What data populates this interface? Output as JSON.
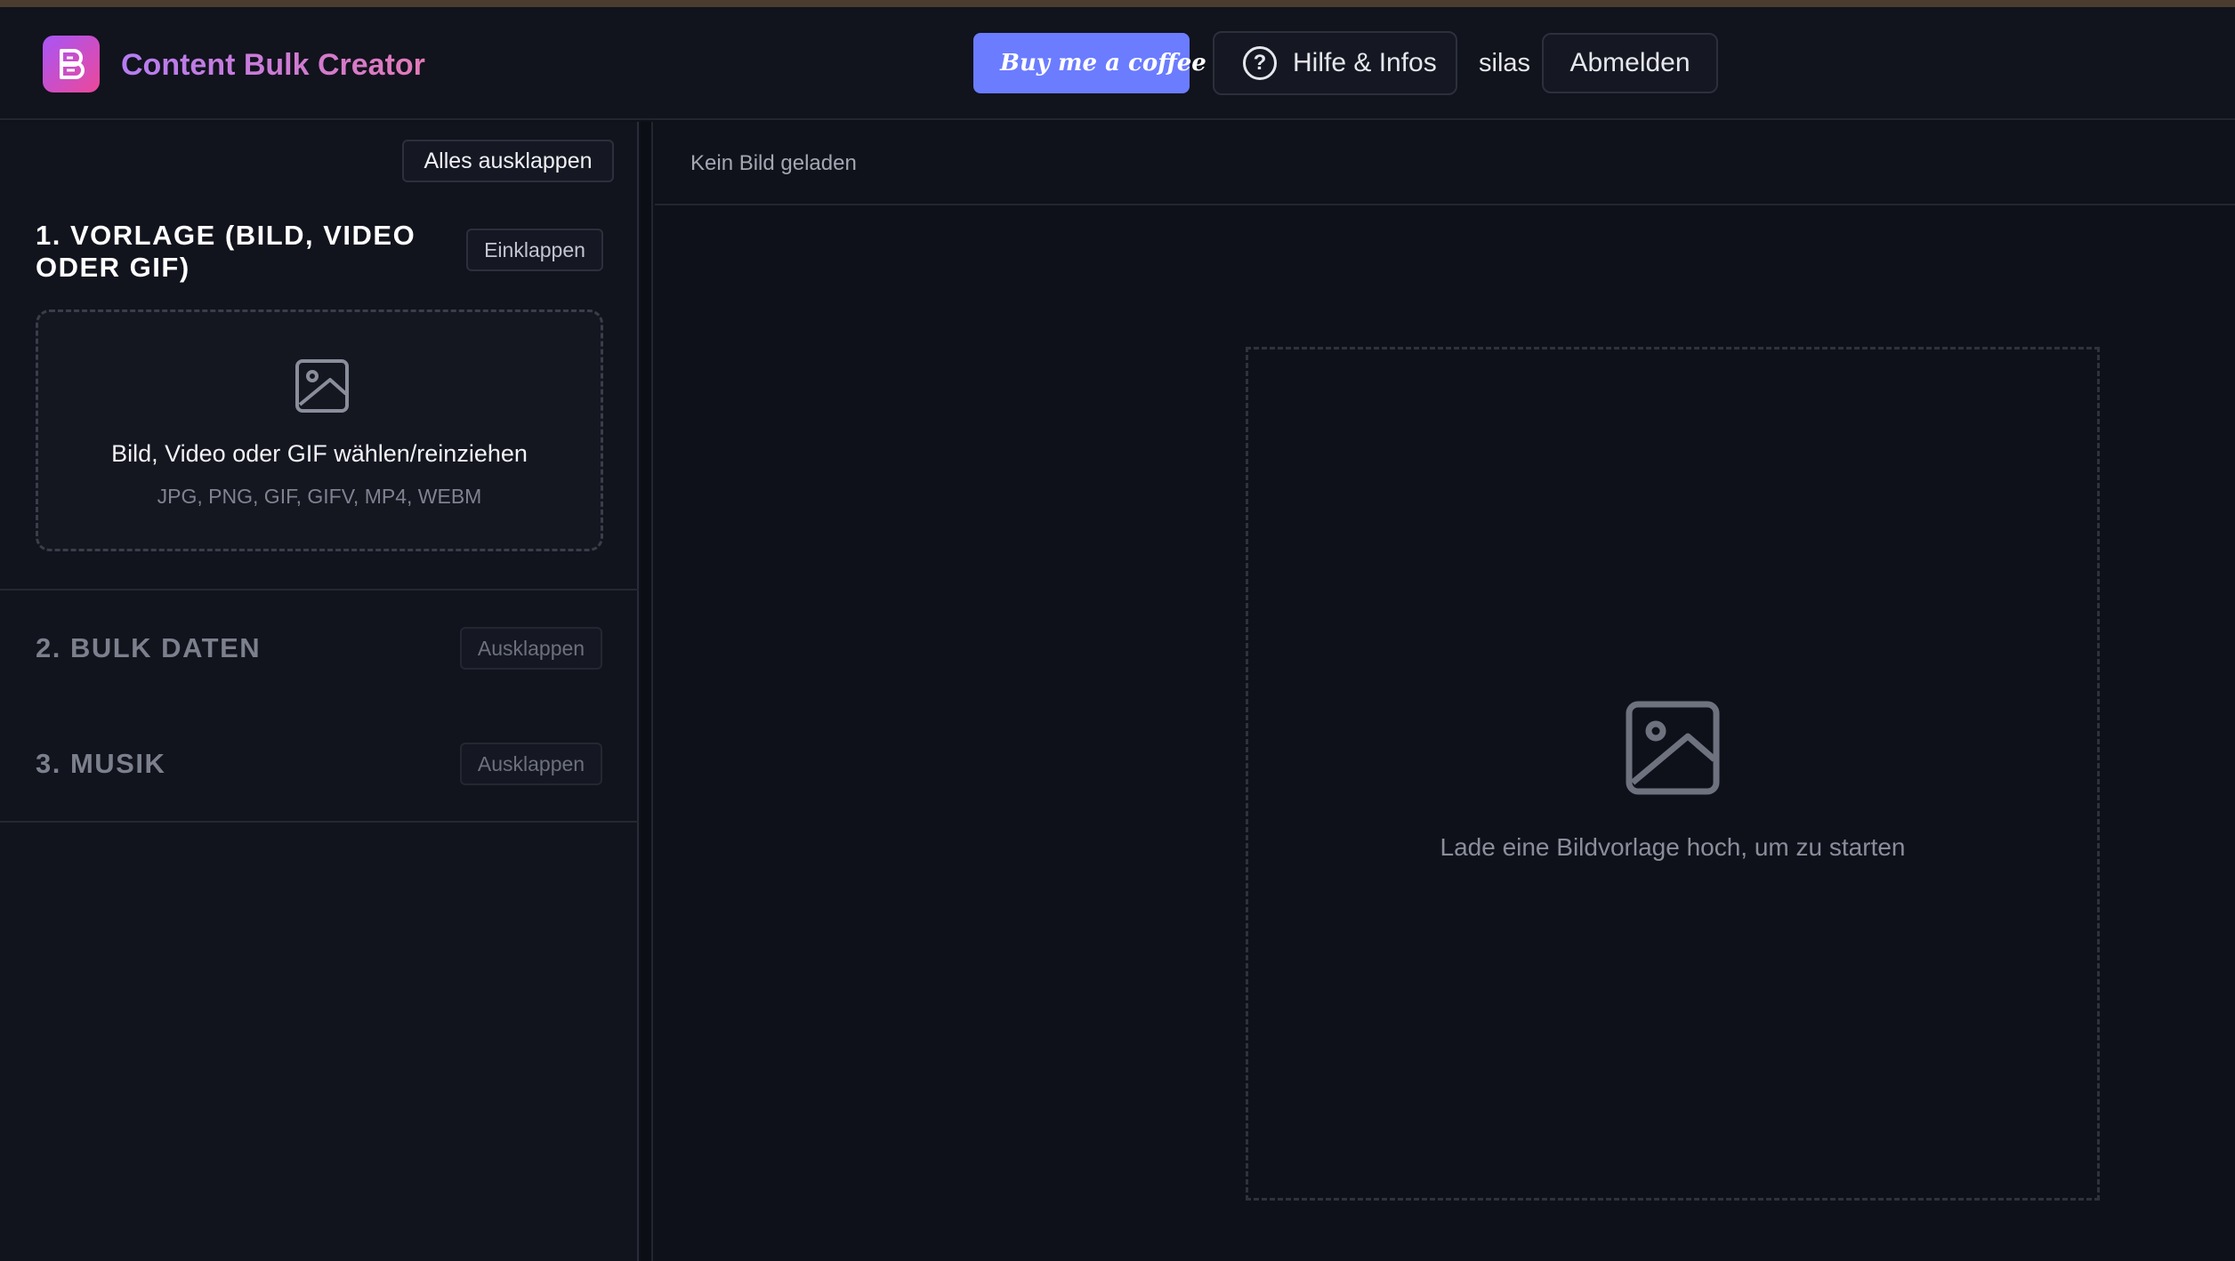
{
  "header": {
    "app_title": "Content Bulk Creator",
    "coffee_label": "Buy me a coffee",
    "help_label": "Hilfe & Infos",
    "username": "silas",
    "logout_label": "Abmelden"
  },
  "sidebar": {
    "expand_all_label": "Alles ausklappen",
    "sections": [
      {
        "title_line1": "1. VORLAGE (BILD, VIDEO",
        "title_line2": "ODER GIF)",
        "toggle_label": "Einklappen",
        "dropzone": {
          "main_text": "Bild, Video oder GIF wählen/reinziehen",
          "sub_text": "JPG, PNG, GIF, GIFV, MP4, WEBM"
        }
      },
      {
        "title": "2. BULK DATEN",
        "toggle_label": "Ausklappen"
      },
      {
        "title": "3. MUSIK",
        "toggle_label": "Ausklappen"
      }
    ]
  },
  "main": {
    "status": "Kein Bild geladen",
    "placeholder": "Lade eine Bildvorlage hoch, um zu starten"
  },
  "colors": {
    "background": "#0f111a",
    "accent_purple": "#a855f7",
    "accent_pink": "#ec4899",
    "coffee_button": "#6b7cff"
  }
}
